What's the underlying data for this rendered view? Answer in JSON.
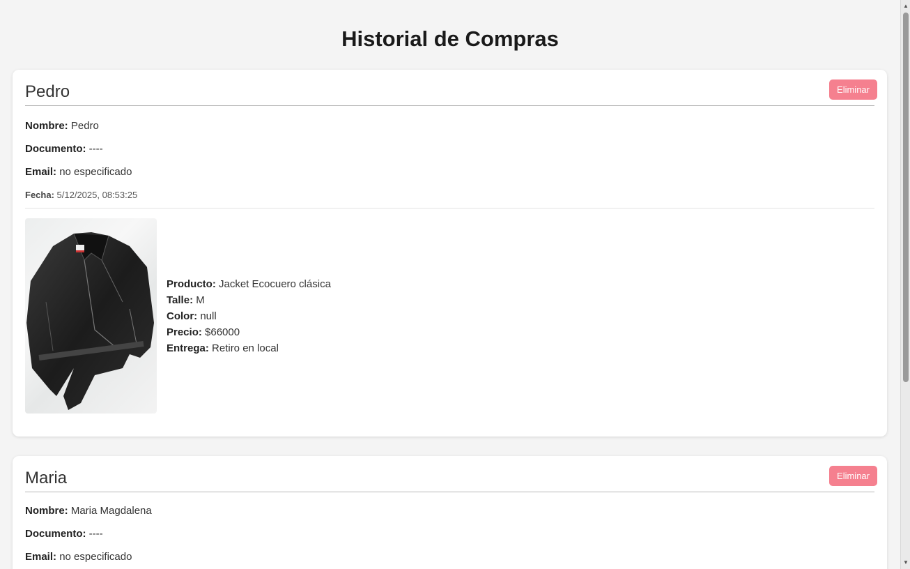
{
  "page": {
    "title": "Historial de Compras"
  },
  "labels": {
    "nombre": "Nombre:",
    "documento": "Documento:",
    "email": "Email:",
    "fecha": "Fecha:",
    "producto": "Producto:",
    "talle": "Talle:",
    "color": "Color:",
    "precio": "Precio:",
    "entrega": "Entrega:"
  },
  "purchases": [
    {
      "header_name": "Pedro",
      "delete_label": "Eliminar",
      "nombre": "Pedro",
      "documento": "----",
      "email": "no especificado",
      "fecha": "5/12/2025, 08:53:25",
      "product": {
        "image_icon": "leather-jacket-image",
        "producto": "Jacket Ecocuero clásica",
        "talle": "M",
        "color": "null",
        "precio": "$66000",
        "entrega": "Retiro en local"
      }
    },
    {
      "header_name": "Maria",
      "delete_label": "Eliminar",
      "nombre": "Maria Magdalena",
      "documento": "----",
      "email": "no especificado"
    }
  ],
  "colors": {
    "delete_button": "#f5808f",
    "background": "#f4f4f4",
    "card": "#ffffff"
  }
}
